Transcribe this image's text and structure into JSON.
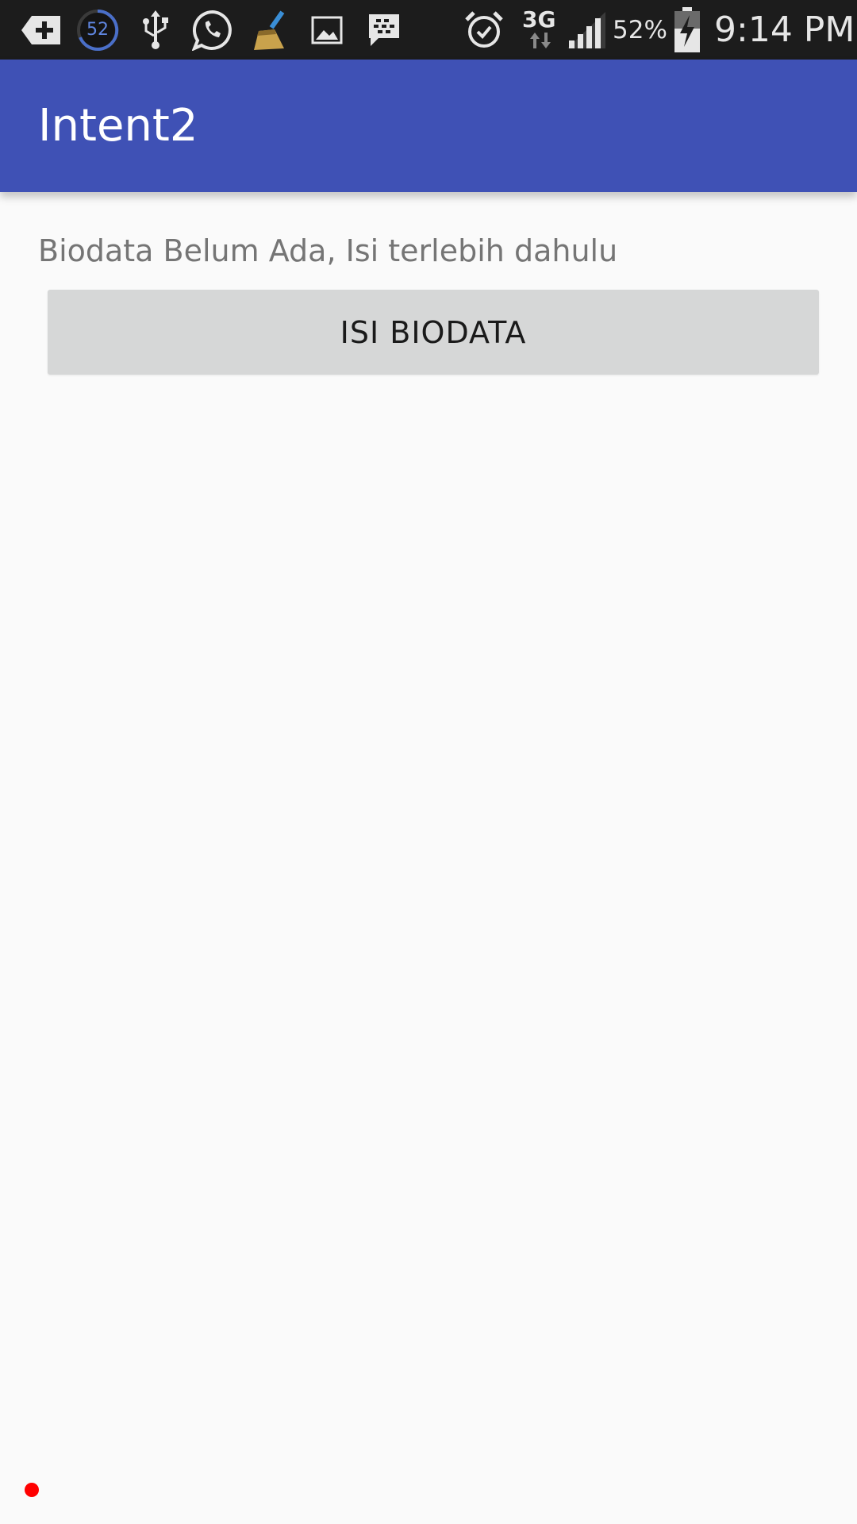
{
  "status_bar": {
    "notification_count": "52",
    "network_type": "3G",
    "battery_percent": "52%",
    "time": "9:14 PM",
    "icons": [
      "add-icon",
      "count-badge-icon",
      "usb-icon",
      "whatsapp-icon",
      "broom-icon",
      "image-icon",
      "bbm-icon",
      "alarm-icon",
      "data-arrows-icon",
      "signal-icon",
      "battery-charging-icon"
    ]
  },
  "app_bar": {
    "title": "Intent2",
    "color": "#3f51b5"
  },
  "main": {
    "message": "Biodata Belum Ada, Isi terlebih dahulu",
    "button_label": "ISI BIODATA"
  }
}
